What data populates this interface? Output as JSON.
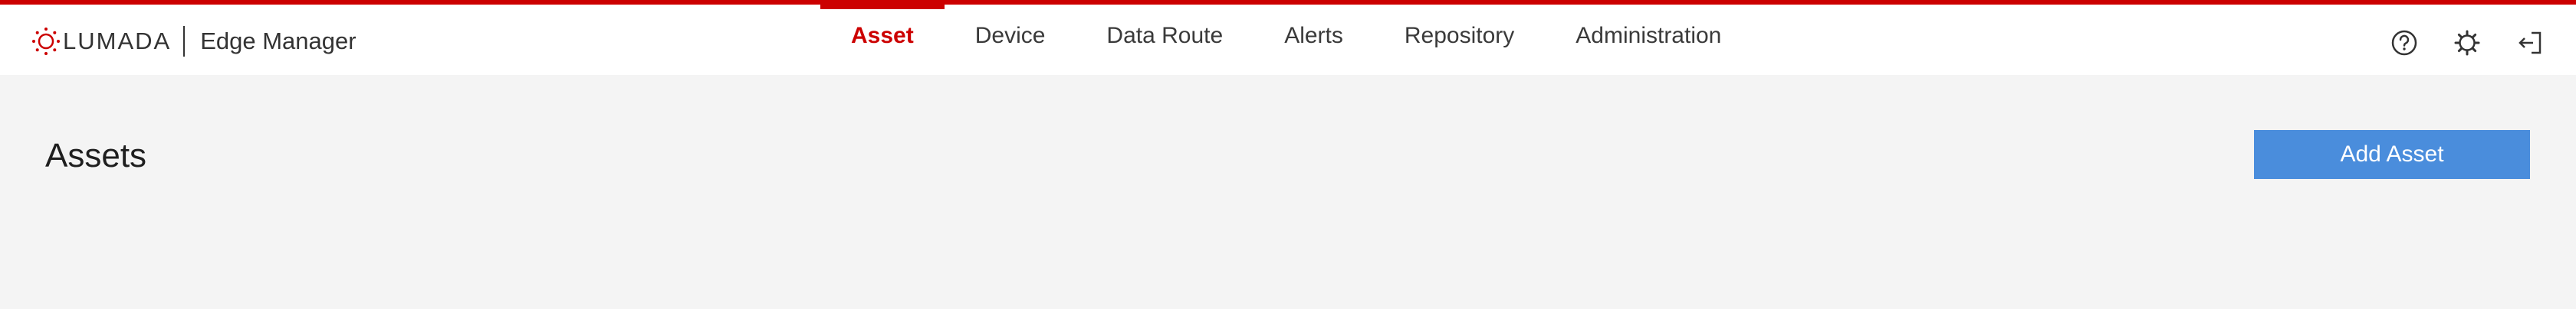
{
  "brand": {
    "logo_icon": "lumada-logo-icon",
    "wordmark": "LUMADA",
    "product": "Edge Manager",
    "accent_color": "#cc0000"
  },
  "nav": {
    "items": [
      {
        "label": "Asset",
        "active": true
      },
      {
        "label": "Device",
        "active": false
      },
      {
        "label": "Data Route",
        "active": false
      },
      {
        "label": "Alerts",
        "active": false
      },
      {
        "label": "Repository",
        "active": false
      },
      {
        "label": "Administration",
        "active": false
      }
    ]
  },
  "header_icons": [
    "help-icon",
    "settings-icon",
    "logout-icon"
  ],
  "page": {
    "title": "Assets",
    "add_button_label": "Add Asset",
    "add_button_color": "#4a8ddc"
  }
}
